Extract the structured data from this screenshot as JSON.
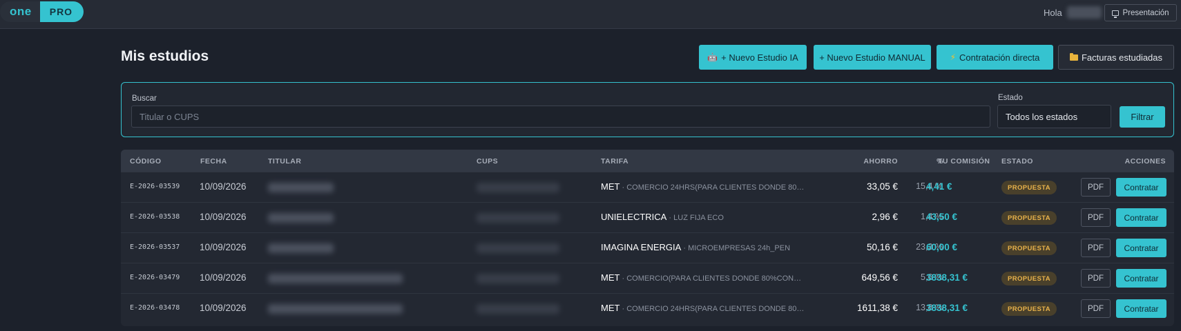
{
  "app": {
    "logo_one": "one",
    "logo_pro": "PRO",
    "greeting": "Hola",
    "user_name": "",
    "presentation_label": "Presentación"
  },
  "page": {
    "title": "Mis estudios"
  },
  "actions": {
    "nuevo_ia": "+ Nuevo Estudio IA",
    "nuevo_manual": "+ Nuevo Estudio MANUAL",
    "contratacion": "Contratación directa",
    "facturas": "Facturas estudiadas"
  },
  "filter": {
    "search_label": "Buscar",
    "search_placeholder": "Titular o CUPS",
    "search_value": "",
    "estado_label": "Estado",
    "estado_value": "Todos los estados",
    "submit_label": "Filtrar"
  },
  "table": {
    "headers": {
      "codigo": "CÓDIGO",
      "fecha": "FECHA",
      "titular": "TITULAR",
      "cups": "CUPS",
      "tarifa": "TARIFA",
      "ahorro": "AHORRO",
      "pct": "%",
      "comision": "TU COMISIÓN",
      "estado": "ESTADO",
      "acciones": "ACCIONES"
    },
    "pdf_label": "PDF",
    "contratar_label": "Contratar",
    "rows": [
      {
        "codigo": "E-2026-03539",
        "fecha": "10/09/2026",
        "comercializadora": "MET",
        "tarifa_desc": " · COMERCIO 24HRS(PARA CLIENTES DONDE 80…",
        "ahorro": "33,05 €",
        "pct": "15,4 %",
        "comision": "4,41 €",
        "estado": "PROPUESTA"
      },
      {
        "codigo": "E-2026-03538",
        "fecha": "10/09/2026",
        "comercializadora": "UNIELECTRICA",
        "tarifa_desc": " · LUZ FIJA ECO",
        "ahorro": "2,96 €",
        "pct": "1,4 %",
        "comision": "43,50 €",
        "estado": "PROPUESTA"
      },
      {
        "codigo": "E-2026-03537",
        "fecha": "10/09/2026",
        "comercializadora": "IMAGINA ENERGIA",
        "tarifa_desc": " · MICROEMPRESAS 24h_PEN",
        "ahorro": "50,16 €",
        "pct": "23,3 %",
        "comision": "60,00 €",
        "estado": "PROPUESTA"
      },
      {
        "codigo": "E-2026-03479",
        "fecha": "10/09/2026",
        "comercializadora": "MET",
        "tarifa_desc": " · COMERCIO(PARA CLIENTES DONDE 80%CON…",
        "ahorro": "649,56 €",
        "pct": "5,6 %",
        "comision": "3838,31 €",
        "estado": "PROPUESTA"
      },
      {
        "codigo": "E-2026-03478",
        "fecha": "10/09/2026",
        "comercializadora": "MET",
        "tarifa_desc": " · COMERCIO 24HRS(PARA CLIENTES DONDE 80…",
        "ahorro": "1611,38 €",
        "pct": "13,8 %",
        "comision": "3838,31 €",
        "estado": "PROPUESTA"
      }
    ]
  },
  "colors": {
    "accent": "#35c3d0",
    "background": "#1c212b",
    "badge_text": "#e9b24a"
  },
  "icons": {
    "nuevo_ia": "robot-icon",
    "contratacion": "lightning-icon",
    "facturas": "folder-icon",
    "presentation": "monitor-icon"
  }
}
